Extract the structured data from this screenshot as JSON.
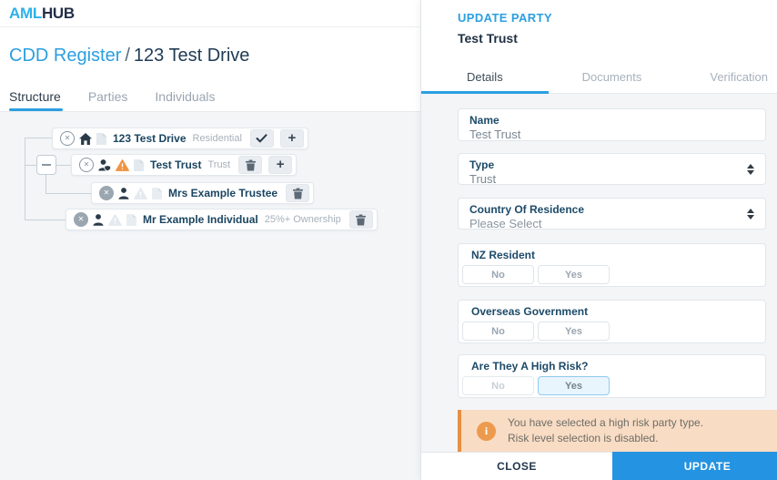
{
  "brand": {
    "aml": "AML",
    "hub": "HUB"
  },
  "breadcrumb": {
    "parent": "CDD Register",
    "separator": "/",
    "current": "123 Test Drive"
  },
  "main_tabs": {
    "structure": "Structure",
    "parties": "Parties",
    "individuals": "Individuals"
  },
  "tree": {
    "nodes": [
      {
        "name": "123 Test Drive",
        "tag": "Residential"
      },
      {
        "name": "Test Trust",
        "tag": "Trust"
      },
      {
        "name": "Mrs Example Trustee",
        "tag": ""
      },
      {
        "name": "Mr Example Individual",
        "tag": "25%+ Ownership"
      }
    ]
  },
  "panel": {
    "title": "UPDATE PARTY",
    "subtitle": "Test Trust",
    "tabs": {
      "details": "Details",
      "documents": "Documents",
      "verification": "Verification"
    },
    "fields": [
      {
        "label": "Name",
        "value": "Test Trust"
      },
      {
        "label": "Type",
        "value": "Trust"
      },
      {
        "label": "Country Of Residence",
        "value": "Please Select"
      }
    ],
    "toggles": [
      {
        "label": "NZ Resident",
        "no": "No",
        "yes": "Yes",
        "selected": ""
      },
      {
        "label": "Overseas Government",
        "no": "No",
        "yes": "Yes",
        "selected": ""
      },
      {
        "label": "Are They A High Risk?",
        "no": "No",
        "yes": "Yes",
        "selected": "Yes"
      }
    ],
    "warning": {
      "line1": "You have selected a high risk party type.",
      "line2": "Risk level selection is disabled.",
      "icon_glyph": "i"
    },
    "footer": {
      "close": "CLOSE",
      "update": "UPDATE"
    }
  },
  "colors": {
    "accent": "#2b9fe0",
    "logo_blue": "#2fb1e8",
    "navy": "#22374e",
    "node_text": "#1a4560",
    "muted": "#a7b1bb",
    "warning_bg": "#f9dcc4",
    "warning_border": "#e78f42",
    "warning_icon": "#ec9b4e",
    "update_button": "#2493e2",
    "toggle_selected_bg": "#e9f5fd"
  }
}
